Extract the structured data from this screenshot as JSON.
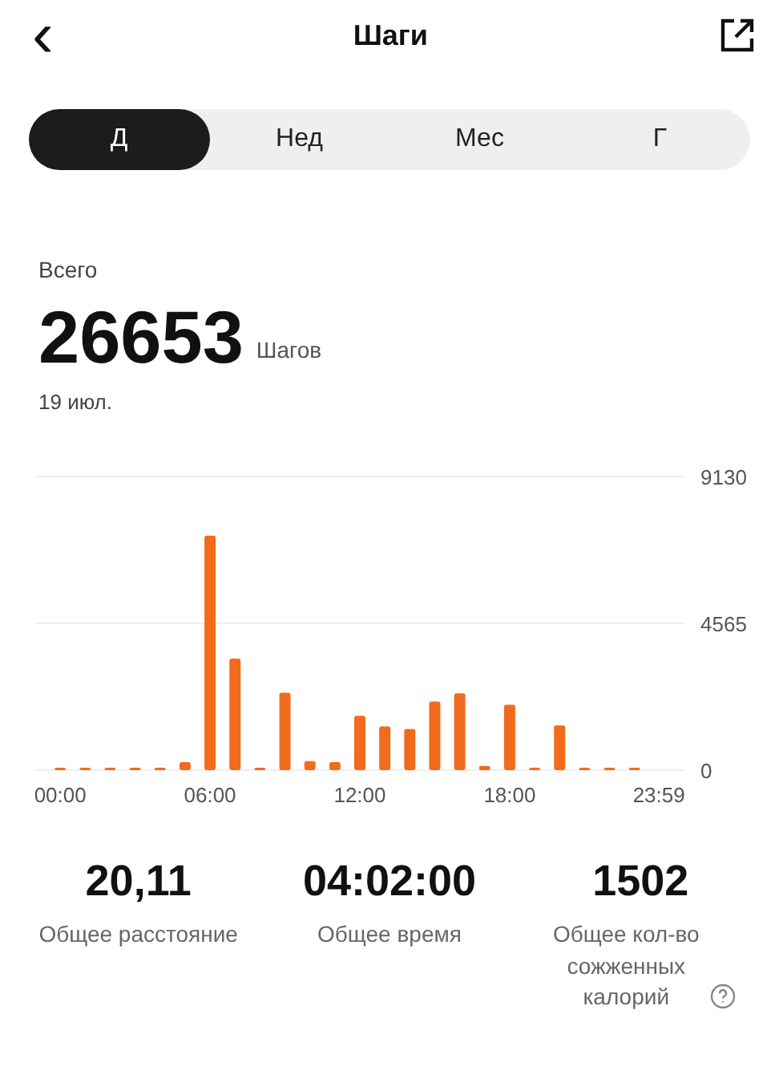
{
  "header": {
    "back": "‹",
    "title": "Шаги"
  },
  "tabs": [
    {
      "label": "Д",
      "selected": true
    },
    {
      "label": "Нед",
      "selected": false
    },
    {
      "label": "Мес",
      "selected": false
    },
    {
      "label": "Г",
      "selected": false
    }
  ],
  "summary": {
    "caption": "Всего",
    "value": "26653",
    "unit": "Шагов",
    "date": "19 июл."
  },
  "chart_data": {
    "type": "bar",
    "x": [
      0,
      1,
      2,
      3,
      4,
      5,
      6,
      7,
      8,
      9,
      10,
      11,
      12,
      13,
      14,
      15,
      16,
      17,
      18,
      19,
      20,
      21,
      22,
      23
    ],
    "series": [
      {
        "color": "#f26b1d",
        "values": [
          0,
          0,
          0,
          0,
          0,
          250,
          7290,
          3470,
          50,
          2410,
          280,
          250,
          1690,
          1360,
          1280,
          2130,
          2390,
          130,
          2030,
          10,
          1390,
          10,
          30,
          0
        ]
      }
    ],
    "xlim": [
      -1,
      25
    ],
    "ylim": [
      0,
      9130
    ],
    "yticks": [
      0,
      4565,
      9130
    ],
    "xticks": [
      {
        "value": 0,
        "label": "00:00"
      },
      {
        "value": 6,
        "label": "06:00"
      },
      {
        "value": 12,
        "label": "12:00"
      },
      {
        "value": 18,
        "label": "18:00"
      },
      {
        "value": 23.98,
        "label": "23:59"
      }
    ]
  },
  "stats": [
    {
      "value": "20,11",
      "label": "Общее расстояние",
      "info": false
    },
    {
      "value": "04:02:00",
      "label": "Общее время",
      "info": false
    },
    {
      "value": "1502",
      "label": "Общее кол-во сожженных калорий",
      "info": true
    }
  ]
}
